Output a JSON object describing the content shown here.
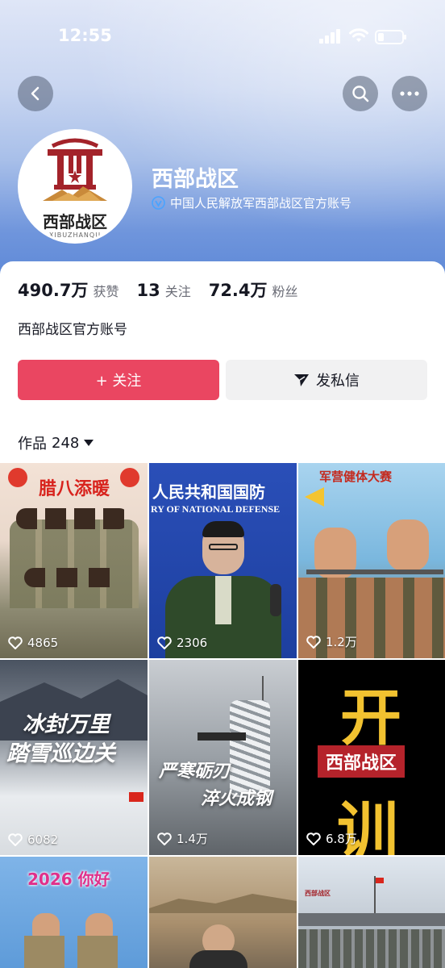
{
  "status_bar": {
    "time": "12:55"
  },
  "profile": {
    "name": "西部战区",
    "verification": "中国人民解放军西部战区官方账号",
    "avatar_text": "西部战区",
    "avatar_sub": "XIBUZHANQU"
  },
  "stats": [
    {
      "value": "490.7万",
      "label": "获赞"
    },
    {
      "value": "13",
      "label": "关注"
    },
    {
      "value": "72.4万",
      "label": "粉丝"
    }
  ],
  "bio": "西部战区官方账号",
  "buttons": {
    "follow": "+ 关注",
    "message": "发私信"
  },
  "works": {
    "label": "作品",
    "count": "248"
  },
  "videos": [
    {
      "likes": "4865",
      "caption": "腊八添暖"
    },
    {
      "likes": "2306",
      "caption": "人民共和国国防",
      "caption2": "RY OF NATIONAL DEFENSE"
    },
    {
      "likes": "1.2万",
      "caption": "军营健体大赛"
    },
    {
      "likes": "6082",
      "caption": "冰封万里",
      "caption2": "踏雪巡边关"
    },
    {
      "likes": "1.4万",
      "caption": "严寒砺刃",
      "caption2": "淬火成钢"
    },
    {
      "likes": "6.8万",
      "caption": "开",
      "caption2": "西部战区",
      "caption3": "训"
    },
    {
      "caption": "2026 你好"
    },
    {
      "caption": ""
    },
    {
      "caption": "西部战区"
    }
  ],
  "colors": {
    "accent": "#ea4661",
    "header_blue": "#6f95dc"
  }
}
